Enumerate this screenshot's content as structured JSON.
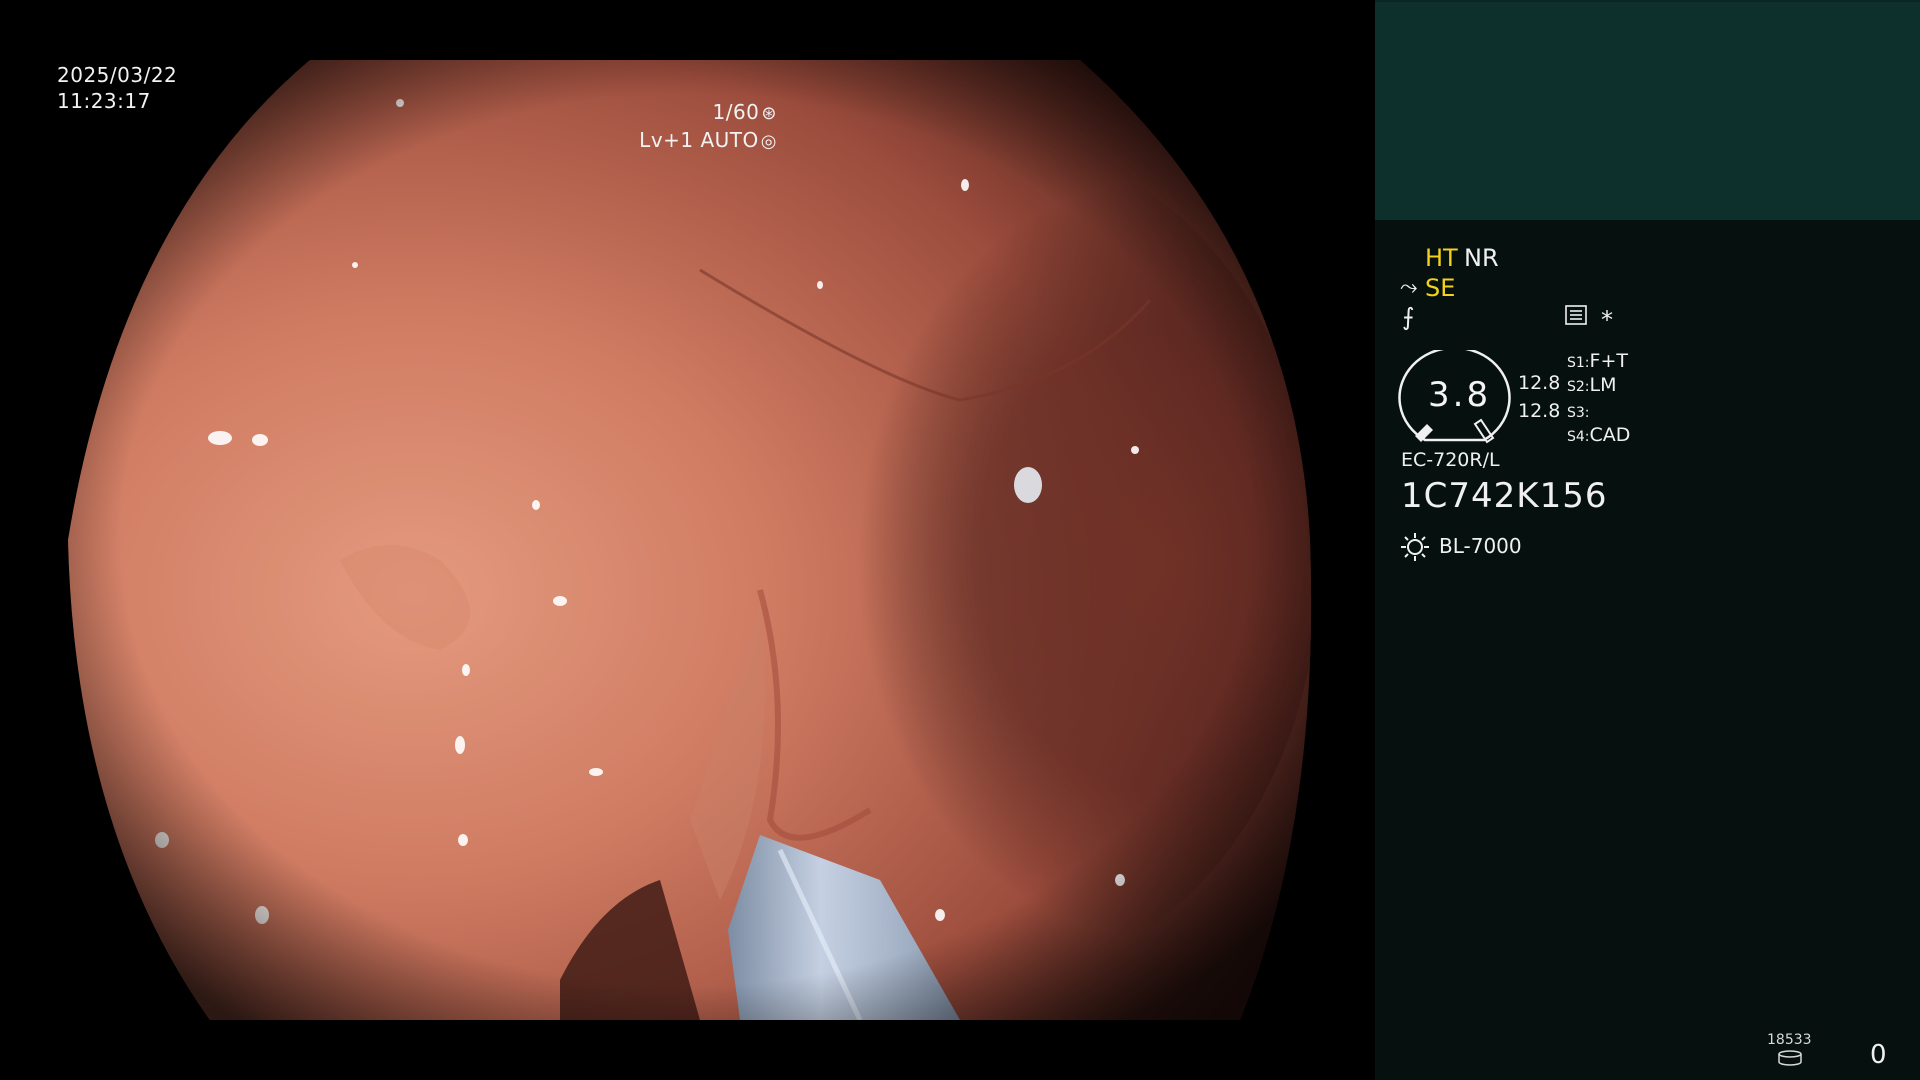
{
  "osd": {
    "date": "2025/03/22",
    "time": "11:23:17",
    "shutter": "1/60",
    "shutter_icon": "aperture-icon",
    "level": "Lv+1 AUTO",
    "level_icon": "iris-icon"
  },
  "panel": {
    "ht": "HT",
    "nr": "NR",
    "se": "SE",
    "se_icon": "scope-tip-icon",
    "wave_icon": "signal-wave-icon",
    "menu_icon": "list-icon",
    "asterisk": "*",
    "gauge_value": "3.8",
    "values": [
      "12.8",
      "12.8"
    ],
    "slots": [
      {
        "key": "S1:",
        "value": "F+T"
      },
      {
        "key": "S2:",
        "value": "LM"
      },
      {
        "key": "S3:",
        "value": ""
      },
      {
        "key": "S4:",
        "value": "CAD"
      }
    ],
    "model": "EC-720R/L",
    "serial": "1C742K156",
    "light_icon": "sun-icon",
    "light_source": "BL-7000",
    "record_count": "18533",
    "record_icon": "disk-icon",
    "counter": "0"
  },
  "colors": {
    "panel_top": "#0e302c",
    "panel_bg": "#06100f",
    "highlight_yellow": "#f2d21c",
    "mucosa": "#c4705a"
  }
}
